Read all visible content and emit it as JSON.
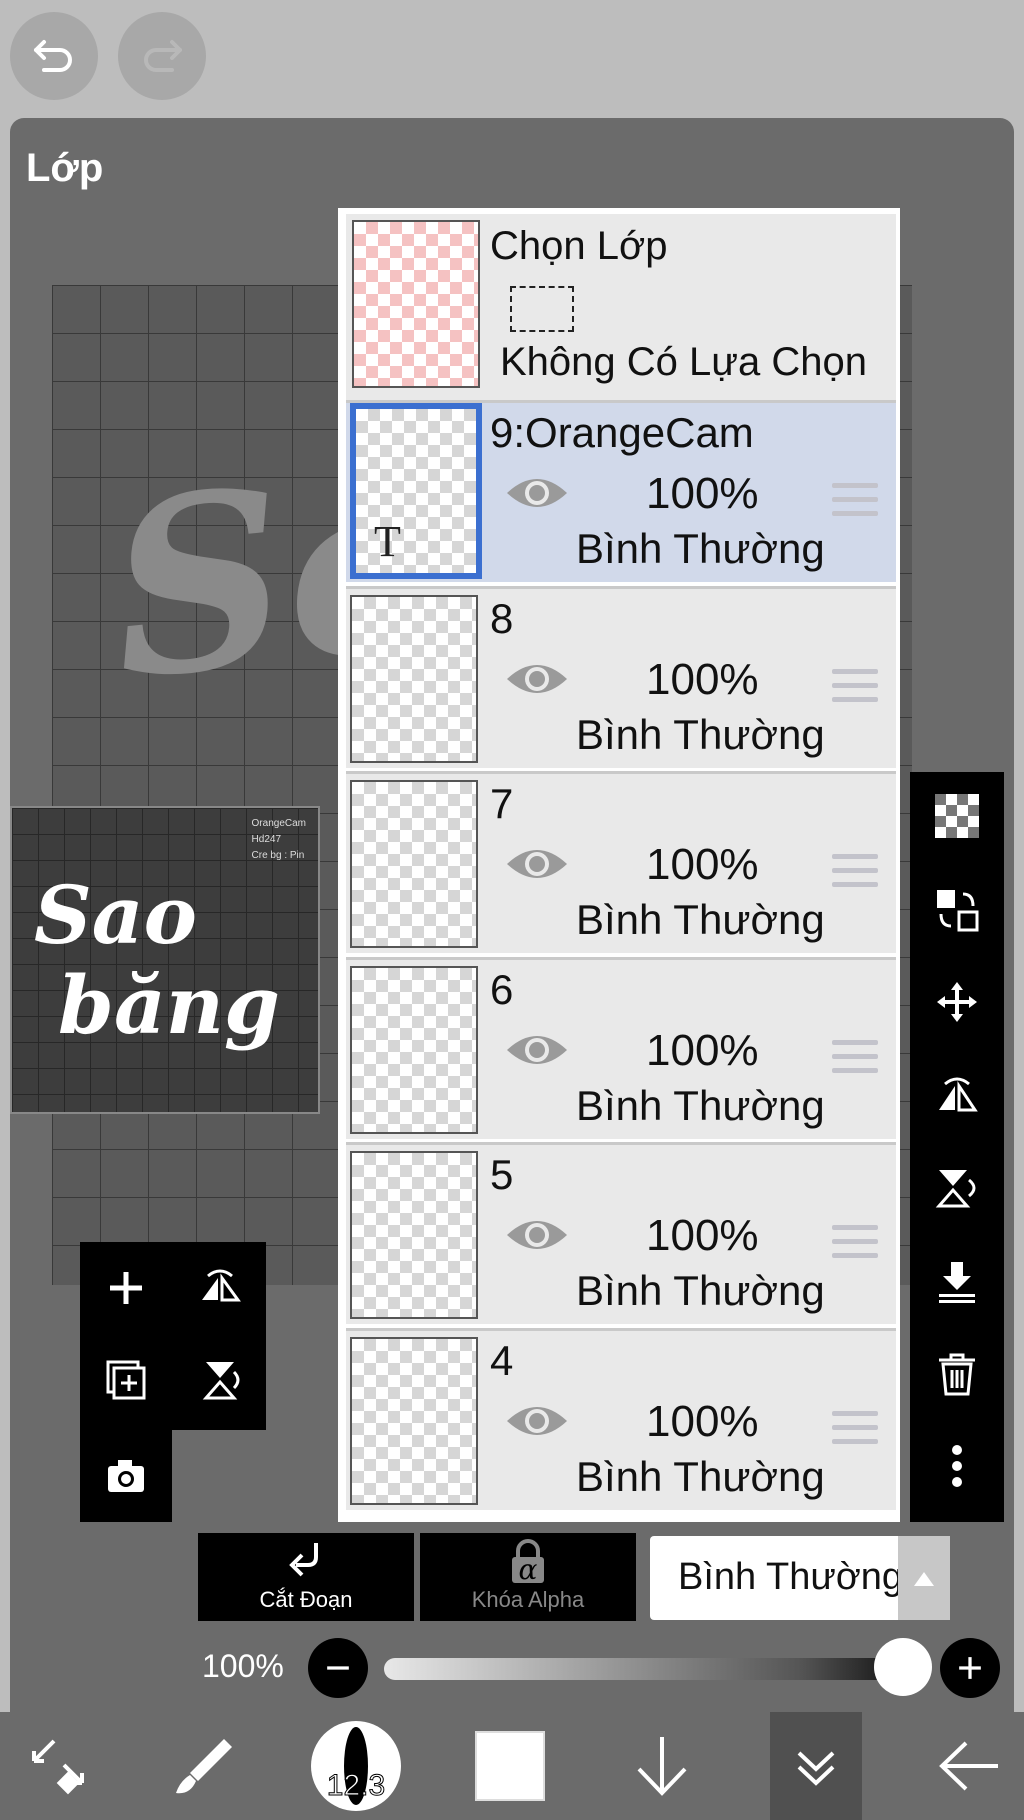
{
  "panel": {
    "title": "Lớp"
  },
  "thumbnail": {
    "credit_lines": [
      "OrangeCam",
      "Hd247",
      "Cre bg : Pin"
    ],
    "line1": "Sao",
    "line2": "băng"
  },
  "selection_layer": {
    "title": "Chọn Lớp",
    "subtitle": "Không Có Lựa Chọn"
  },
  "layers": [
    {
      "name": "9:OrangeCam",
      "opacity": "100%",
      "blend": "Bình Thường",
      "active": true,
      "type": "text"
    },
    {
      "name": "8",
      "opacity": "100%",
      "blend": "Bình Thường",
      "active": false,
      "type": "image"
    },
    {
      "name": "7",
      "opacity": "100%",
      "blend": "Bình Thường",
      "active": false,
      "type": "image"
    },
    {
      "name": "6",
      "opacity": "100%",
      "blend": "Bình Thường",
      "active": false,
      "type": "image"
    },
    {
      "name": "5",
      "opacity": "100%",
      "blend": "Bình Thường",
      "active": false,
      "type": "image"
    },
    {
      "name": "4",
      "opacity": "100%",
      "blend": "Bình Thường",
      "active": false,
      "type": "image"
    }
  ],
  "controls": {
    "clip_label": "Cắt Đoạn",
    "alpha_lock_label": "Khóa Alpha",
    "alpha_symbol": "α",
    "blend_mode": "Bình Thường",
    "opacity_label": "100%",
    "opacity_value": 1.0
  },
  "bottom_bar": {
    "brush_size": "12.3"
  },
  "colors": {
    "panel_bg": "#6b6b6b",
    "active_layer_bg": "#d1d9ea",
    "active_border": "#3b6fd0"
  }
}
